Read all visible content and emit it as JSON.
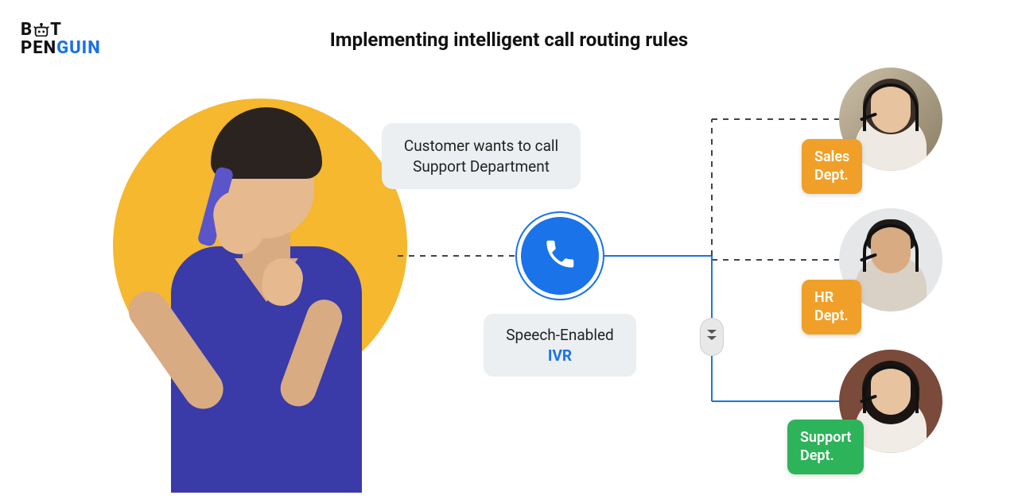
{
  "brand": {
    "line1_bot": "B",
    "line1_t": "T",
    "line2_pen": "PEN",
    "line2_guin": "GUIN"
  },
  "title": "Implementing intelligent call routing rules",
  "customer_bubble": "Customer wants to call Support Department",
  "ivr": {
    "label_line1": "Speech-Enabled",
    "label_line2": "IVR"
  },
  "departments": {
    "sales": {
      "line1": "Sales",
      "line2": "Dept.",
      "color": "orange",
      "selected": false
    },
    "hr": {
      "line1": "HR",
      "line2": "Dept.",
      "color": "orange",
      "selected": false
    },
    "support": {
      "line1": "Support",
      "line2": "Dept.",
      "color": "green",
      "selected": true
    }
  },
  "icons": {
    "phone": "phone-icon",
    "robot_head": "robot-head-icon",
    "chevrons_down": "double-chevron-down-icon"
  },
  "colors": {
    "accent_blue": "#1a73e8",
    "accent_yellow": "#f5b82e",
    "badge_orange": "#f0a029",
    "badge_green": "#2db35a",
    "bubble_gray": "#eceff1"
  }
}
